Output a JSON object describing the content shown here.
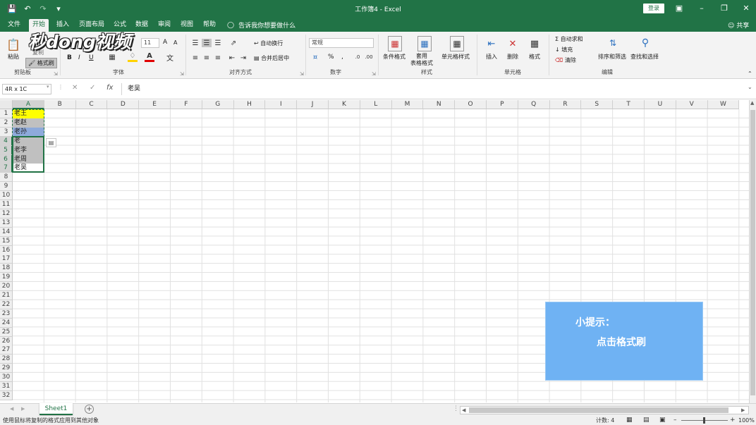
{
  "window": {
    "title": "工作簿4 - Excel",
    "login_label": "登录",
    "share_label": "共享"
  },
  "tabs": [
    "文件",
    "开始",
    "插入",
    "页面布局",
    "公式",
    "数据",
    "审阅",
    "视图",
    "帮助"
  ],
  "tell_me": "告诉我你想要做什么",
  "watermark": "秒dong视频",
  "ribbon": {
    "clipboard": {
      "paste": "粘贴",
      "copy": "复制",
      "format_painter": "格式刷",
      "label": "剪贴板"
    },
    "font": {
      "size": "11",
      "grow": "A",
      "shrink": "A",
      "bold": "B",
      "italic": "I",
      "underline": "U",
      "label": "字体"
    },
    "alignment": {
      "wrap": "自动换行",
      "merge": "合并后居中",
      "label": "对齐方式"
    },
    "number": {
      "format": "常规",
      "percent": "%",
      "comma": ",",
      "label": "数字"
    },
    "styles": {
      "conditional": "条件格式",
      "table": "套用\n表格格式",
      "cell_styles": "单元格样式",
      "label": "样式"
    },
    "cells": {
      "insert": "插入",
      "delete": "删除",
      "format": "格式",
      "label": "单元格"
    },
    "editing": {
      "autosum": "自动求和",
      "fill": "填充",
      "clear": "清除",
      "sort": "排序和筛选",
      "find": "查找和选择",
      "label": "编辑"
    }
  },
  "formula_bar": {
    "name_box": "4R x 1C",
    "cancel": "✕",
    "enter": "✓",
    "fx": "fx",
    "content": "老吴"
  },
  "columns": [
    "A",
    "B",
    "C",
    "D",
    "E",
    "F",
    "G",
    "H",
    "I",
    "J",
    "K",
    "L",
    "M",
    "N",
    "O",
    "P",
    "Q",
    "R",
    "S",
    "T",
    "U",
    "V",
    "W"
  ],
  "rows": [
    "1",
    "2",
    "3",
    "4",
    "5",
    "6",
    "7",
    "8",
    "9",
    "10",
    "11",
    "12",
    "13",
    "14",
    "15",
    "16",
    "17",
    "18",
    "19",
    "20",
    "21",
    "22",
    "23",
    "24",
    "25",
    "26",
    "27",
    "28",
    "29",
    "30",
    "31",
    "32"
  ],
  "cells": [
    {
      "value": "老王",
      "bg": "#ffff00"
    },
    {
      "value": "老赵",
      "bg": "#c0c0c0"
    },
    {
      "value": "老孙",
      "bg": "#8eaadb"
    },
    {
      "value": "老",
      "bg": "#c0c0c0"
    },
    {
      "value": "老李",
      "bg": "#c0c0c0"
    },
    {
      "value": "老周",
      "bg": "#c0c0c0"
    },
    {
      "value": "老吴",
      "bg": "#ffffff"
    }
  ],
  "tip": {
    "line1": "小提示：",
    "line2": "点击格式刷"
  },
  "sheet": {
    "name": "Sheet1",
    "add": "+"
  },
  "status": {
    "message": "使用鼠标将复制的格式应用到其他对象",
    "count": "计数: 4",
    "zoom": "100%"
  },
  "colors": {
    "accent": "#217346",
    "tip_bg": "#6fb2f3"
  }
}
